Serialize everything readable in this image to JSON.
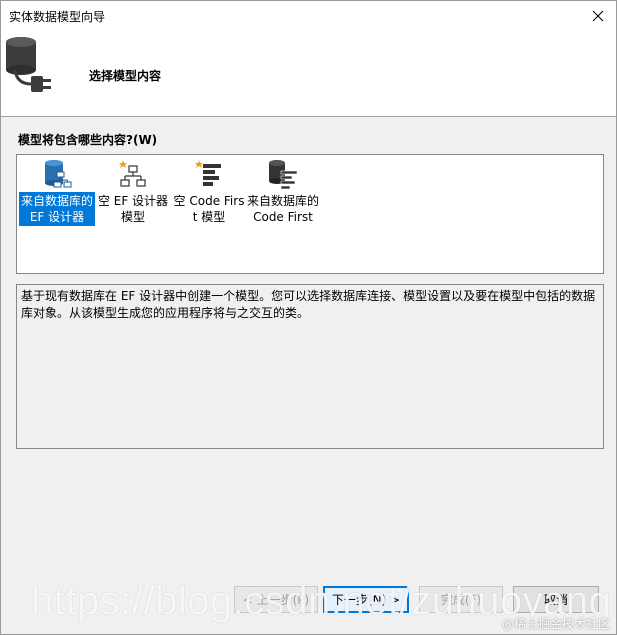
{
  "window": {
    "title": "实体数据模型向导"
  },
  "header": {
    "title": "选择模型内容"
  },
  "section": {
    "label": "模型将包含哪些内容?(W)"
  },
  "options": [
    {
      "label": "来自数据库的 EF 设计器",
      "selected": true,
      "icon": "database-designer-icon"
    },
    {
      "label": "空 EF 设计器模型",
      "selected": false,
      "icon": "empty-designer-icon"
    },
    {
      "label": "空 Code First 模型",
      "selected": false,
      "icon": "empty-code-first-icon"
    },
    {
      "label": "来自数据库的 Code First",
      "selected": false,
      "icon": "database-code-first-icon"
    }
  ],
  "description": "基于现有数据库在 EF 设计器中创建一个模型。您可以选择数据库连接、模型设置以及要在模型中包括的数据库对象。从该模型生成您的应用程序将与之交互的类。",
  "buttons": {
    "prev": "< 上一步(P)",
    "next": "下一步(N) >",
    "finish": "完成(F)",
    "cancel": "取消"
  },
  "watermark": {
    "url": "https://blog.csdn.net/zuhuoyang",
    "credit": "@稀土掘金技术社区"
  },
  "colors": {
    "selection": "#0078d7",
    "default_border": "#0078d7"
  }
}
